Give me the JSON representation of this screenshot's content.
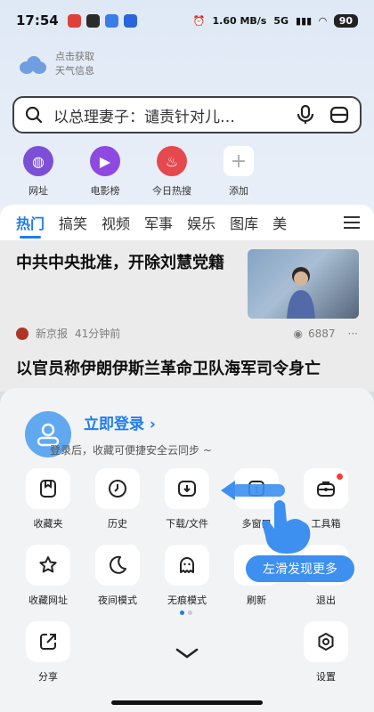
{
  "status_bar": {
    "time": "17:54",
    "net_speed": "1.60 MB/s",
    "signal": "5G",
    "battery": "90"
  },
  "weather": {
    "line1": "点击获取",
    "line2": "天气信息"
  },
  "search": {
    "query": "以总理妻子：谴责针对儿…"
  },
  "shortcuts": [
    {
      "label": "网址",
      "color": "#7b4fd6"
    },
    {
      "label": "电影榜",
      "color": "#8f48e0"
    },
    {
      "label": "今日热搜",
      "color": "#e5484d"
    },
    {
      "label": "添加",
      "color": "#ffffff"
    }
  ],
  "tabs": [
    "热门",
    "搞笑",
    "视频",
    "军事",
    "娱乐",
    "图库",
    "美"
  ],
  "news": [
    {
      "title": "中共中央批准，开除刘慧党籍",
      "source": "新京报",
      "time": "41分钟前",
      "views": "6887"
    },
    {
      "title": "以官员称伊朗伊斯兰革命卫队海军司令身亡"
    }
  ],
  "sheet": {
    "login_title": "立即登录",
    "login_sub": "登录后，收藏可便捷安全云同步 ~",
    "row1": [
      {
        "label": "收藏夹",
        "icon": "bookmark-icon"
      },
      {
        "label": "历史",
        "icon": "clock-icon"
      },
      {
        "label": "下载/文件",
        "icon": "download-icon"
      },
      {
        "label": "多窗口",
        "icon": "windows-icon",
        "count": "1"
      },
      {
        "label": "工具箱",
        "icon": "toolbox-icon"
      }
    ],
    "row2": [
      {
        "label": "收藏网址",
        "icon": "star-icon"
      },
      {
        "label": "夜间模式",
        "icon": "moon-icon"
      },
      {
        "label": "无痕模式",
        "icon": "ghost-icon"
      },
      {
        "label": "刷新",
        "icon": "refresh-icon"
      },
      {
        "label": "退出",
        "icon": "power-icon"
      }
    ],
    "bottom": [
      {
        "label": "分享",
        "icon": "share-icon"
      },
      {
        "label": "设置",
        "icon": "settings-icon"
      }
    ],
    "hint": "左滑发现更多",
    "accent": "#1e7cf0"
  }
}
